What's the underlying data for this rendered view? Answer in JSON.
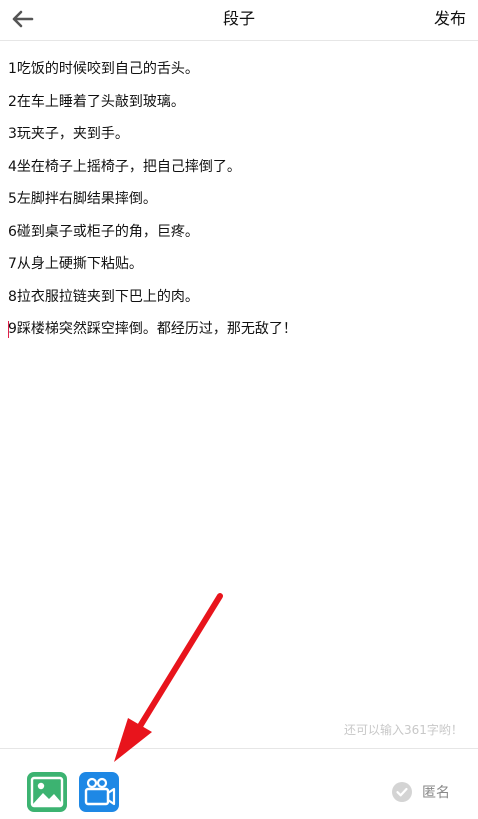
{
  "header": {
    "back_icon": "arrow-left-icon",
    "title": "段子",
    "publish_label": "发布"
  },
  "editor": {
    "lines": [
      "1吃饭的时候咬到自己的舌头。",
      "2在车上睡着了头敲到玻璃。",
      "3玩夹子，夹到手。",
      "4坐在椅子上摇椅子，把自己摔倒了。",
      "5左脚拌右脚结果摔倒。",
      "6碰到桌子或柜子的角，巨疼。",
      "7从身上硬撕下粘贴。",
      "8拉衣服拉链夹到下巴上的肉。",
      "9踩楼梯突然踩空摔倒。都经历过，那无敌了！"
    ],
    "char_counter": "还可以输入361字哟！",
    "caret_color": "#e0204a"
  },
  "bottom": {
    "image_icon": "image-icon",
    "video_icon": "video-camera-icon",
    "anonymous_icon": "check-circle-icon",
    "anonymous_label": "匿名",
    "image_color": "#3cb371",
    "video_color": "#1e88e5"
  },
  "annotation": {
    "arrow_color": "#e8141c",
    "arrow_icon": "red-arrow-icon"
  }
}
